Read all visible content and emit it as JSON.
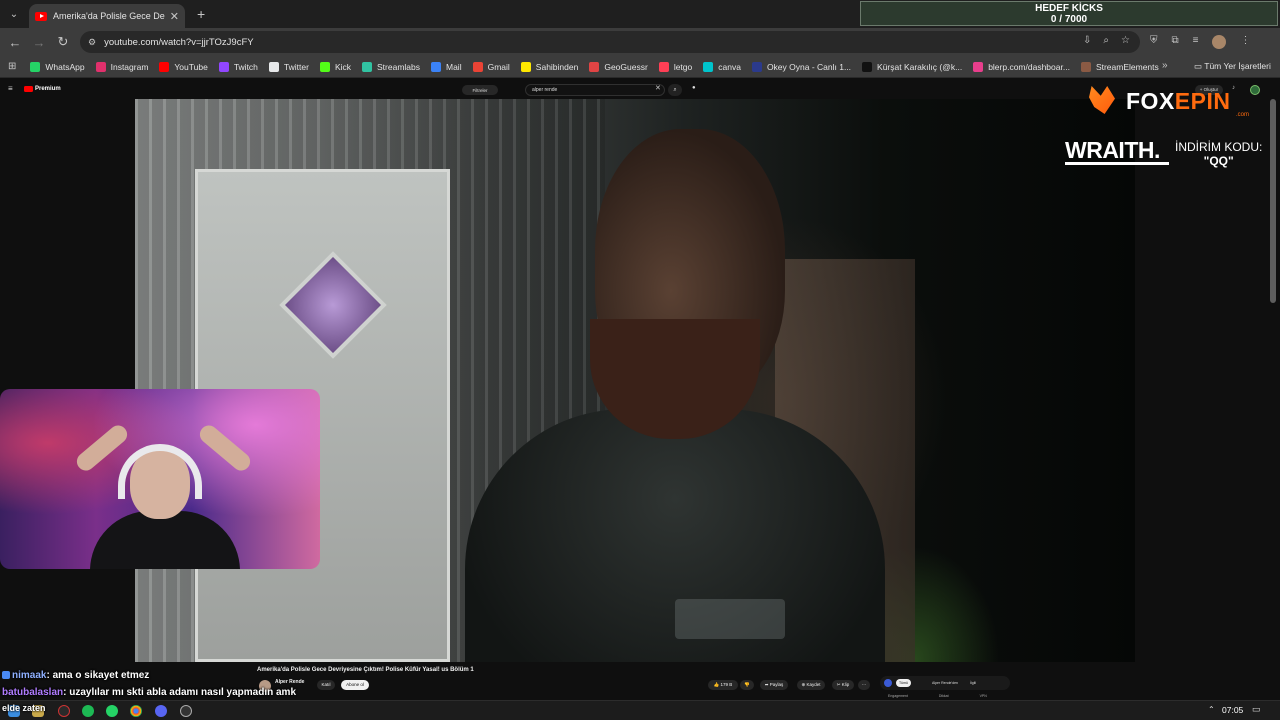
{
  "browser": {
    "tab_title": "Amerika'da Polisle Gece De",
    "url": "youtube.com/watch?v=jjrTOzJ9cFY"
  },
  "goal": {
    "title": "HEDEF KİCKS",
    "progress_text": "0 / 7000",
    "current": 0,
    "target": 7000
  },
  "bookmarks": [
    {
      "label": "WhatsApp",
      "color": "#25d366"
    },
    {
      "label": "Instagram",
      "color": "#e1306c"
    },
    {
      "label": "YouTube",
      "color": "#ff0000"
    },
    {
      "label": "Twitch",
      "color": "#9146ff"
    },
    {
      "label": "Twitter",
      "color": "#e7e9ea"
    },
    {
      "label": "Kick",
      "color": "#53fc18"
    },
    {
      "label": "Streamlabs",
      "color": "#31c3a2"
    },
    {
      "label": "Mail",
      "color": "#3b82f6"
    },
    {
      "label": "Gmail",
      "color": "#ea4335"
    },
    {
      "label": "Sahibinden",
      "color": "#ffe800"
    },
    {
      "label": "GeoGuessr",
      "color": "#e04444"
    },
    {
      "label": "letgo",
      "color": "#ff3f55"
    },
    {
      "label": "canva",
      "color": "#00c4cc"
    },
    {
      "label": "Okey Oyna - Canlı 1...",
      "color": "#2b3a8c"
    },
    {
      "label": "Kürşat Karakılıç (@k...",
      "color": "#111111"
    },
    {
      "label": "blerp.com/dashboar...",
      "color": "#e83e8c"
    },
    {
      "label": "StreamElements",
      "color": "#8a5a44"
    }
  ],
  "bookmarks_all": "Tüm Yer İşaretleri",
  "youtube": {
    "brand": "Premium",
    "filter_label": "Filtreler",
    "search_query": "alper rende",
    "create_label": "+ Oluştur"
  },
  "overlay": {
    "brand_fox": "FOX",
    "brand_epin": "EPIN",
    "brand_com": ".com",
    "wraith": "WRAITH.",
    "discount_label": "İNDİRİM KODU:",
    "discount_code": "\"QQ\""
  },
  "video": {
    "title": "Amerika'da Polisle Gece Devriyesine Çıktım! Polise Küfür Yasal! us Bölüm 1",
    "channel": "Alper Rende",
    "subscribers": "",
    "join": "Katıl",
    "subscribe": "Abone ol",
    "likes": "179 B",
    "share": "Paylaş",
    "save": "Kaydet",
    "clip": "Klip",
    "chips": [
      "Tümü",
      "Alper Rende'den",
      "İlgili"
    ],
    "side_row": [
      "Engagement",
      "Dikkat",
      "VPN"
    ]
  },
  "chat": [
    {
      "user": "nimaak",
      "message": ": ama o sikayet etmez"
    },
    {
      "user": "batubalaslan",
      "message": ": uzaylılar mı skti abla adamı nasıl yapmadın amk"
    },
    {
      "user": "",
      "message": "elde zaten"
    }
  ],
  "taskbar": {
    "time": "07:05"
  }
}
